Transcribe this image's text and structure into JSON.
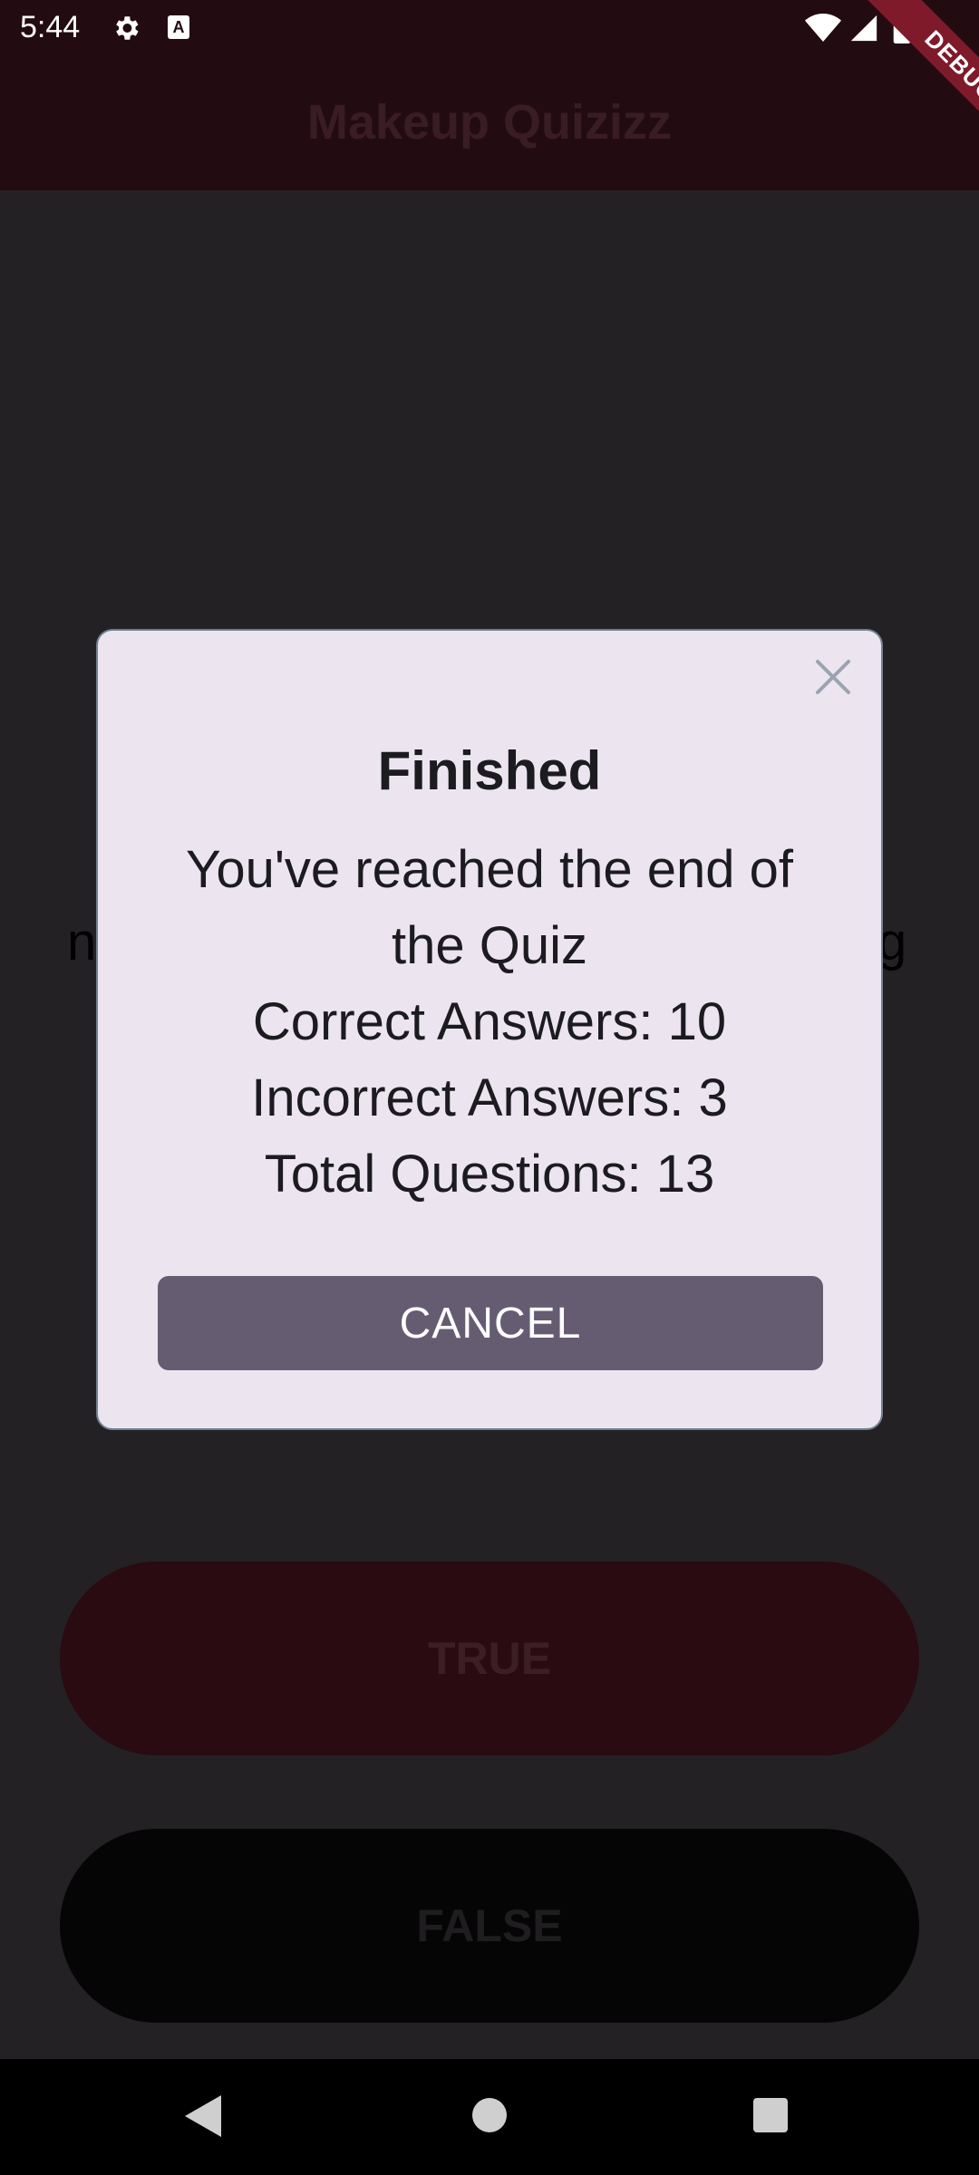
{
  "status_bar": {
    "time": "5:44"
  },
  "app_bar": {
    "title": "Makeup Quizizz"
  },
  "debug_banner": {
    "label": "DEBUG"
  },
  "background": {
    "question_left_fragment": "n",
    "question_right_fragment": "g"
  },
  "answers": {
    "true_label": "TRUE",
    "false_label": "FALSE"
  },
  "dialog": {
    "title": "Finished",
    "message_line1": "You've reached the end of",
    "message_line2": "the Quiz",
    "correct": "Correct Answers: 10",
    "incorrect": "Incorrect Answers: 3",
    "total": "Total Questions: 13",
    "cancel_label": "CANCEL"
  },
  "colors": {
    "app_bar": "#230b12",
    "dialog_bg": "#ece5f0",
    "cancel_button": "#655c72",
    "scrim": "#242124"
  }
}
